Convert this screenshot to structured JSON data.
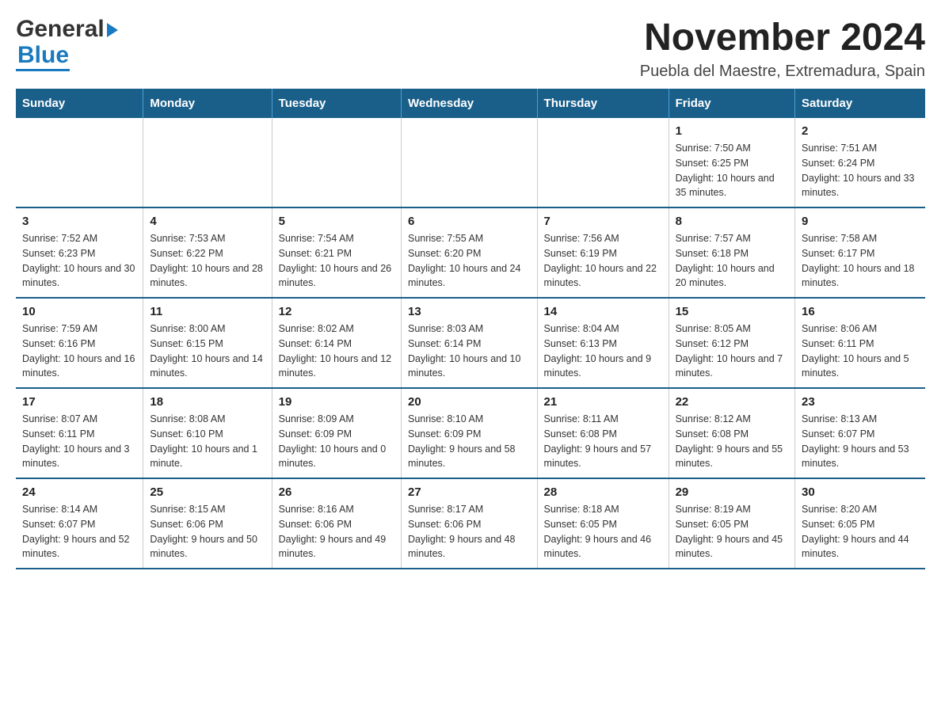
{
  "logo": {
    "text_general": "General",
    "text_blue": "Blue",
    "tagline": ""
  },
  "title": "November 2024",
  "subtitle": "Puebla del Maestre, Extremadura, Spain",
  "days_of_week": [
    "Sunday",
    "Monday",
    "Tuesday",
    "Wednesday",
    "Thursday",
    "Friday",
    "Saturday"
  ],
  "weeks": [
    {
      "days": [
        {
          "number": "",
          "info": ""
        },
        {
          "number": "",
          "info": ""
        },
        {
          "number": "",
          "info": ""
        },
        {
          "number": "",
          "info": ""
        },
        {
          "number": "",
          "info": ""
        },
        {
          "number": "1",
          "info": "Sunrise: 7:50 AM\nSunset: 6:25 PM\nDaylight: 10 hours and 35 minutes."
        },
        {
          "number": "2",
          "info": "Sunrise: 7:51 AM\nSunset: 6:24 PM\nDaylight: 10 hours and 33 minutes."
        }
      ]
    },
    {
      "days": [
        {
          "number": "3",
          "info": "Sunrise: 7:52 AM\nSunset: 6:23 PM\nDaylight: 10 hours and 30 minutes."
        },
        {
          "number": "4",
          "info": "Sunrise: 7:53 AM\nSunset: 6:22 PM\nDaylight: 10 hours and 28 minutes."
        },
        {
          "number": "5",
          "info": "Sunrise: 7:54 AM\nSunset: 6:21 PM\nDaylight: 10 hours and 26 minutes."
        },
        {
          "number": "6",
          "info": "Sunrise: 7:55 AM\nSunset: 6:20 PM\nDaylight: 10 hours and 24 minutes."
        },
        {
          "number": "7",
          "info": "Sunrise: 7:56 AM\nSunset: 6:19 PM\nDaylight: 10 hours and 22 minutes."
        },
        {
          "number": "8",
          "info": "Sunrise: 7:57 AM\nSunset: 6:18 PM\nDaylight: 10 hours and 20 minutes."
        },
        {
          "number": "9",
          "info": "Sunrise: 7:58 AM\nSunset: 6:17 PM\nDaylight: 10 hours and 18 minutes."
        }
      ]
    },
    {
      "days": [
        {
          "number": "10",
          "info": "Sunrise: 7:59 AM\nSunset: 6:16 PM\nDaylight: 10 hours and 16 minutes."
        },
        {
          "number": "11",
          "info": "Sunrise: 8:00 AM\nSunset: 6:15 PM\nDaylight: 10 hours and 14 minutes."
        },
        {
          "number": "12",
          "info": "Sunrise: 8:02 AM\nSunset: 6:14 PM\nDaylight: 10 hours and 12 minutes."
        },
        {
          "number": "13",
          "info": "Sunrise: 8:03 AM\nSunset: 6:14 PM\nDaylight: 10 hours and 10 minutes."
        },
        {
          "number": "14",
          "info": "Sunrise: 8:04 AM\nSunset: 6:13 PM\nDaylight: 10 hours and 9 minutes."
        },
        {
          "number": "15",
          "info": "Sunrise: 8:05 AM\nSunset: 6:12 PM\nDaylight: 10 hours and 7 minutes."
        },
        {
          "number": "16",
          "info": "Sunrise: 8:06 AM\nSunset: 6:11 PM\nDaylight: 10 hours and 5 minutes."
        }
      ]
    },
    {
      "days": [
        {
          "number": "17",
          "info": "Sunrise: 8:07 AM\nSunset: 6:11 PM\nDaylight: 10 hours and 3 minutes."
        },
        {
          "number": "18",
          "info": "Sunrise: 8:08 AM\nSunset: 6:10 PM\nDaylight: 10 hours and 1 minute."
        },
        {
          "number": "19",
          "info": "Sunrise: 8:09 AM\nSunset: 6:09 PM\nDaylight: 10 hours and 0 minutes."
        },
        {
          "number": "20",
          "info": "Sunrise: 8:10 AM\nSunset: 6:09 PM\nDaylight: 9 hours and 58 minutes."
        },
        {
          "number": "21",
          "info": "Sunrise: 8:11 AM\nSunset: 6:08 PM\nDaylight: 9 hours and 57 minutes."
        },
        {
          "number": "22",
          "info": "Sunrise: 8:12 AM\nSunset: 6:08 PM\nDaylight: 9 hours and 55 minutes."
        },
        {
          "number": "23",
          "info": "Sunrise: 8:13 AM\nSunset: 6:07 PM\nDaylight: 9 hours and 53 minutes."
        }
      ]
    },
    {
      "days": [
        {
          "number": "24",
          "info": "Sunrise: 8:14 AM\nSunset: 6:07 PM\nDaylight: 9 hours and 52 minutes."
        },
        {
          "number": "25",
          "info": "Sunrise: 8:15 AM\nSunset: 6:06 PM\nDaylight: 9 hours and 50 minutes."
        },
        {
          "number": "26",
          "info": "Sunrise: 8:16 AM\nSunset: 6:06 PM\nDaylight: 9 hours and 49 minutes."
        },
        {
          "number": "27",
          "info": "Sunrise: 8:17 AM\nSunset: 6:06 PM\nDaylight: 9 hours and 48 minutes."
        },
        {
          "number": "28",
          "info": "Sunrise: 8:18 AM\nSunset: 6:05 PM\nDaylight: 9 hours and 46 minutes."
        },
        {
          "number": "29",
          "info": "Sunrise: 8:19 AM\nSunset: 6:05 PM\nDaylight: 9 hours and 45 minutes."
        },
        {
          "number": "30",
          "info": "Sunrise: 8:20 AM\nSunset: 6:05 PM\nDaylight: 9 hours and 44 minutes."
        }
      ]
    }
  ]
}
